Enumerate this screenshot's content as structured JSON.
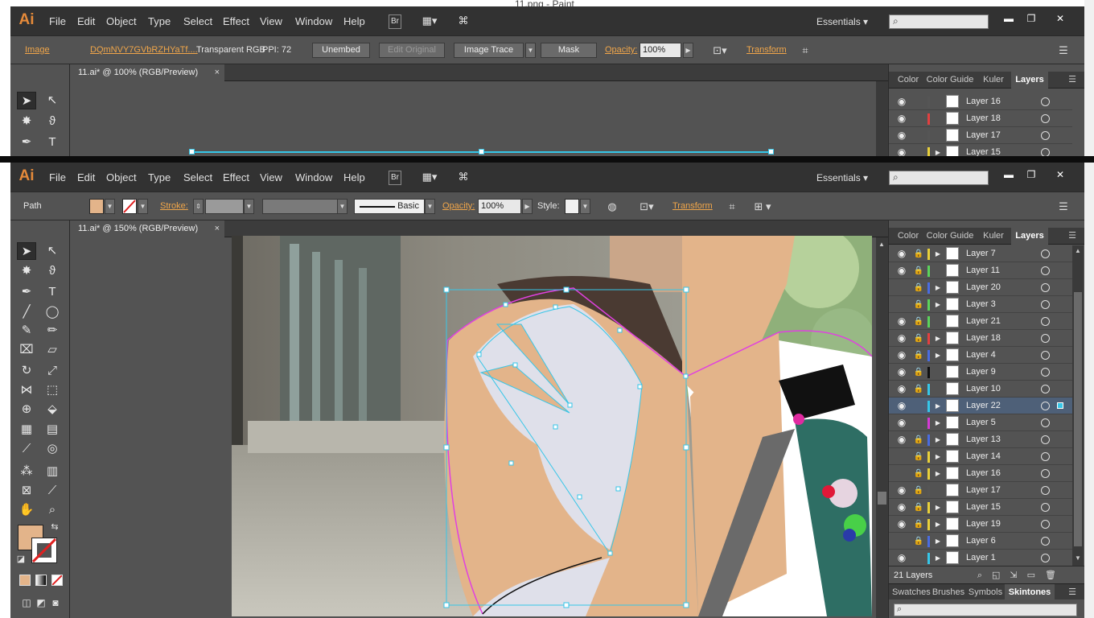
{
  "behind_window": {
    "title": "11.png - Paint"
  },
  "menubar": {
    "logo": "Ai",
    "items": [
      "File",
      "Edit",
      "Object",
      "Type",
      "Select",
      "Effect",
      "View",
      "Window",
      "Help"
    ],
    "bridge_label": "Br",
    "workspace": "Essentials",
    "workspace_caret": "▾",
    "search_placeholder": "",
    "minimize": "▬",
    "maximize": "❐",
    "close": "✕"
  },
  "back_window": {
    "control_bar": {
      "object_type": "Image",
      "file_name": "DQmNVY7GVbRZHYaTf....",
      "color_mode": "Transparent RGB",
      "ppi": "PPI: 72",
      "unembed": "Unembed",
      "edit_original": "Edit Original",
      "image_trace": "Image Trace",
      "mask": "Mask",
      "opacity_label": "Opacity:",
      "opacity_value": "100%",
      "transform_label": "Transform"
    },
    "doc_tab": "11.ai* @ 100% (RGB/Preview)",
    "panel_tabs": [
      "Color",
      "Color Guide",
      "Kuler",
      "Layers"
    ],
    "layers": [
      {
        "name": "Layer 16",
        "color": "#555555"
      },
      {
        "name": "Layer 18",
        "color": "#e14040"
      },
      {
        "name": "Layer 17",
        "color": "#555555"
      },
      {
        "name": "Layer 15",
        "color": "#e8d03a"
      }
    ]
  },
  "front_window": {
    "control_bar": {
      "object_type": "Path",
      "fill_color": "#e3b48a",
      "stroke_label": "Stroke:",
      "stroke_profile": "Basic",
      "opacity_label": "Opacity:",
      "opacity_value": "100%",
      "style_label": "Style:",
      "transform_label": "Transform"
    },
    "doc_tab": "11.ai* @ 150% (RGB/Preview)",
    "close_tab": "×",
    "panel_tabs": [
      "Color",
      "Color Guide",
      "Kuler",
      "Layers"
    ],
    "layers": [
      {
        "name": "Layer 7",
        "color": "#e8d03a",
        "eye": true,
        "lock": true,
        "expand": true
      },
      {
        "name": "Layer 11",
        "color": "#5bd35b",
        "eye": true,
        "lock": true,
        "expand": false
      },
      {
        "name": "Layer 20",
        "color": "#4a6ce0",
        "eye": false,
        "lock": true,
        "expand": true
      },
      {
        "name": "Layer 3",
        "color": "#5bd35b",
        "eye": false,
        "lock": true,
        "expand": true
      },
      {
        "name": "Layer 21",
        "color": "#5bd35b",
        "eye": true,
        "lock": true,
        "expand": false
      },
      {
        "name": "Layer 18",
        "color": "#e14040",
        "eye": true,
        "lock": true,
        "expand": true
      },
      {
        "name": "Layer 4",
        "color": "#4a6ce0",
        "eye": true,
        "lock": true,
        "expand": true
      },
      {
        "name": "Layer 9",
        "color": "#111111",
        "eye": true,
        "lock": true,
        "expand": false
      },
      {
        "name": "Layer 10",
        "color": "#36c6e8",
        "eye": true,
        "lock": true,
        "expand": false
      },
      {
        "name": "Layer 22",
        "color": "#36c6e8",
        "eye": true,
        "lock": false,
        "expand": true,
        "active": true
      },
      {
        "name": "Layer 5",
        "color": "#d43ad4",
        "eye": true,
        "lock": false,
        "expand": true
      },
      {
        "name": "Layer 13",
        "color": "#4a6ce0",
        "eye": true,
        "lock": true,
        "expand": true
      },
      {
        "name": "Layer 14",
        "color": "#e8d03a",
        "eye": false,
        "lock": true,
        "expand": true
      },
      {
        "name": "Layer 16",
        "color": "#e8d03a",
        "eye": false,
        "lock": true,
        "expand": true
      },
      {
        "name": "Layer 17",
        "color": "#555555",
        "eye": true,
        "lock": true,
        "expand": false
      },
      {
        "name": "Layer 15",
        "color": "#e8d03a",
        "eye": true,
        "lock": true,
        "expand": true
      },
      {
        "name": "Layer 19",
        "color": "#e8d03a",
        "eye": true,
        "lock": true,
        "expand": true
      },
      {
        "name": "Layer 6",
        "color": "#4a6ce0",
        "eye": false,
        "lock": true,
        "expand": true
      },
      {
        "name": "Layer 1",
        "color": "#36c6e8",
        "eye": true,
        "lock": false,
        "expand": true
      }
    ],
    "layers_count": "21 Layers",
    "panel_tabs_bottom": [
      "Swatches",
      "Brushes",
      "Symbols",
      "Skintones"
    ],
    "bottom_search_placeholder": ""
  },
  "icons": {
    "eye": "eye-icon",
    "lock": "lock-icon",
    "expand": "triangle-right-icon",
    "target": "target-circle-icon",
    "search": "search-icon"
  },
  "colors": {
    "ui_dark": "#323232",
    "ui_mid": "#535353",
    "accent_orange": "#f0a64a",
    "selection_cyan": "#36c6e8",
    "path_magenta": "#e040e0",
    "skin_fill": "#e3b48a"
  }
}
